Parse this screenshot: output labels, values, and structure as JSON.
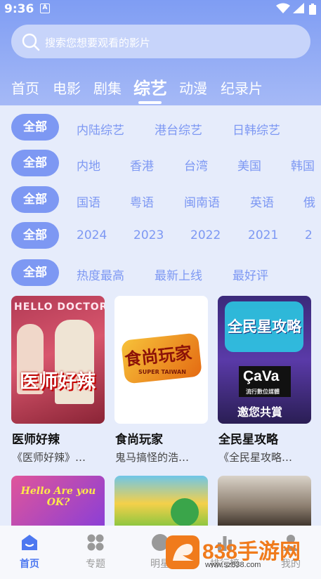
{
  "status_bar": {
    "time": "9:36",
    "notif_icon": "A"
  },
  "search": {
    "placeholder": "搜索您想要观看的影片"
  },
  "tabs": [
    {
      "label": "首页"
    },
    {
      "label": "电影"
    },
    {
      "label": "剧集"
    },
    {
      "label": "综艺",
      "active": true
    },
    {
      "label": "动漫"
    },
    {
      "label": "纪录片"
    }
  ],
  "filters": [
    {
      "all": "全部",
      "options": [
        "内陆综艺",
        "港台综艺",
        "日韩综艺"
      ]
    },
    {
      "all": "全部",
      "options": [
        "内地",
        "香港",
        "台湾",
        "美国",
        "韩国"
      ]
    },
    {
      "all": "全部",
      "options": [
        "国语",
        "粤语",
        "闽南语",
        "英语",
        "俄"
      ]
    },
    {
      "all": "全部",
      "options": [
        "2024",
        "2023",
        "2022",
        "2021",
        "2"
      ]
    },
    {
      "all": "全部",
      "options": [
        "热度最高",
        "最新上线",
        "最好评"
      ]
    }
  ],
  "cards": [
    {
      "title": "医师好辣",
      "desc": "《医师好辣》…",
      "poster_text": "医师好辣",
      "poster_top": "HELLO DOCTOR"
    },
    {
      "title": "食尚玩家",
      "desc": "鬼马搞怪的浩…",
      "poster_text": "食尚玩家",
      "poster_sub": "SUPER TAIWAN"
    },
    {
      "title": "全民星攻略",
      "desc": "《全民星攻略…",
      "poster_text": "全民星攻略",
      "poster_brand": "ÇaVa",
      "poster_brand_sub": "流行數位媒體",
      "poster_bottom": "邀您共賞"
    }
  ],
  "second_row": [
    {
      "poster_text": "Hello Are you OK?"
    },
    {
      "poster_text": ""
    },
    {
      "poster_text": ""
    }
  ],
  "tabbar": [
    {
      "label": "首页",
      "icon": "home-icon",
      "active": true
    },
    {
      "label": "专题",
      "icon": "grid-icon"
    },
    {
      "label": "明星",
      "icon": "star-icon"
    },
    {
      "label": "排行榜",
      "icon": "chart-icon"
    },
    {
      "label": "我的",
      "icon": "user-icon"
    }
  ],
  "watermark": {
    "brand": "838手游网",
    "url": "www.sz838.com"
  },
  "colors": {
    "accent": "#7d98f3",
    "header_top": "#7f9df3",
    "background": "#e6ecfb"
  }
}
